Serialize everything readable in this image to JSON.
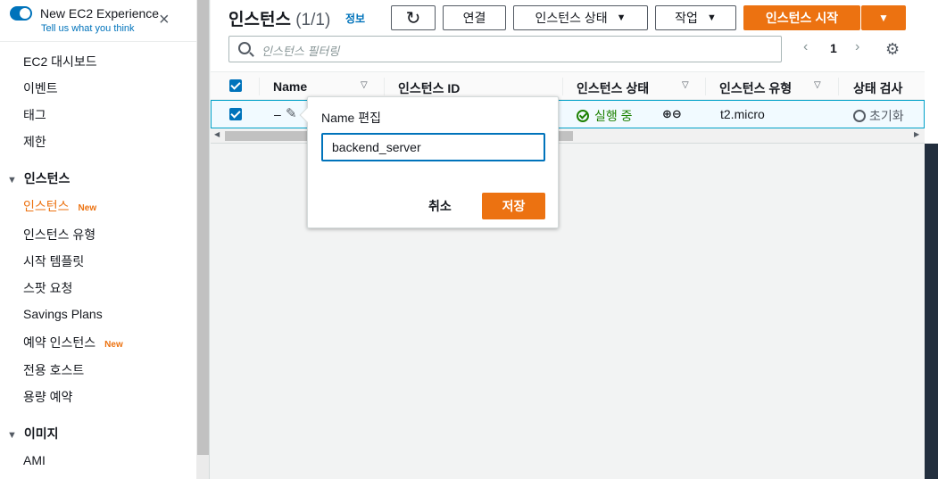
{
  "experience": {
    "title": "New EC2 Experience",
    "subtitle": "Tell us what you think",
    "close_icon": "×"
  },
  "sidebar": {
    "top_items": [
      "EC2 대시보드",
      "이벤트",
      "태그",
      "제한"
    ],
    "instances_section": "인스턴스",
    "instances_items": [
      {
        "label": "인스턴스",
        "badge": "New",
        "active": true
      },
      {
        "label": "인스턴스 유형"
      },
      {
        "label": "시작 템플릿"
      },
      {
        "label": "스팟 요청"
      },
      {
        "label": "Savings Plans"
      },
      {
        "label": "예약 인스턴스",
        "badge": "New"
      },
      {
        "label": "전용 호스트"
      },
      {
        "label": "용량 예약"
      }
    ],
    "images_section": "이미지",
    "images_items": [
      "AMI"
    ]
  },
  "header": {
    "title": "인스턴스",
    "count": "(1/1)",
    "info_link": "정보",
    "refresh_icon": "↻",
    "connect_button": "연결",
    "instance_state_button": "인스턴스 상태",
    "actions_button": "작업",
    "launch_button": "인스턴스 시작",
    "dropdown_icon": "▼"
  },
  "search": {
    "placeholder": "인스턴스 필터링"
  },
  "pagination": {
    "prev_icon": "‹",
    "page": "1",
    "next_icon": "›",
    "settings_icon": "⚙"
  },
  "table": {
    "columns": [
      "Name",
      "인스턴스 ID",
      "인스턴스 상태",
      "인스턴스 유형",
      "상태 검사"
    ],
    "row": {
      "name": "–",
      "state": "실행 중",
      "zoom": "⊕⊖",
      "type": "t2.micro",
      "status_check": "초기화"
    }
  },
  "popover": {
    "label": "Name 편집",
    "value": "backend_server",
    "cancel": "취소",
    "save": "저장"
  },
  "colors": {
    "accent": "#ec7211",
    "link": "#0073bb",
    "success": "#1d8102"
  }
}
